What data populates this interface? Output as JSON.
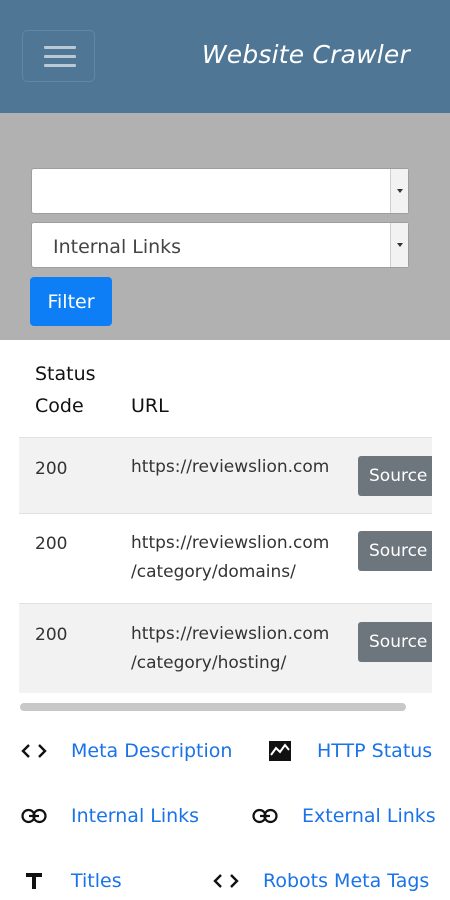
{
  "header": {
    "title": "Website Crawler"
  },
  "filters": {
    "first_select_value": "",
    "second_select_value": "Internal Links",
    "filter_label": "Filter"
  },
  "table": {
    "col_status": "Status\nCode",
    "col_url": "URL",
    "rows": [
      {
        "code": "200",
        "url_line1": "https://reviewslion.com",
        "url_line2": "",
        "action": "Source"
      },
      {
        "code": "200",
        "url_line1": "https://reviewslion.com",
        "url_line2": "/category/domains/",
        "action": "Source"
      },
      {
        "code": "200",
        "url_line1": "https://reviewslion.com",
        "url_line2": "/category/hosting/",
        "action": "Source"
      }
    ]
  },
  "bottom_nav": [
    {
      "icon": "code-icon",
      "label": "Meta Description"
    },
    {
      "icon": "chart-icon",
      "label": "HTTP Status"
    },
    {
      "icon": "link-icon",
      "label": "Internal Links"
    },
    {
      "icon": "link-icon",
      "label": "External Links"
    },
    {
      "icon": "text-icon",
      "label": "Titles"
    },
    {
      "icon": "code-icon",
      "label": "Robots Meta Tags"
    }
  ]
}
